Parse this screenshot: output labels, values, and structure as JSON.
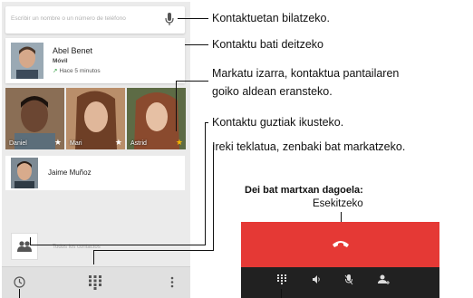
{
  "phone": {
    "search": {
      "placeholder": "Escribir un nombre o un número de teléfono",
      "icon": "mic-icon"
    },
    "recent_contact": {
      "name": "Abel Benet",
      "type": "Móvil",
      "time": "Hace 5 minutos"
    },
    "favorites": [
      {
        "name": "Daniel",
        "starred": true
      },
      {
        "name": "Mari",
        "starred": true
      },
      {
        "name": "Astrid",
        "starred": true
      }
    ],
    "contact_row": {
      "name": "Jaime Muñoz"
    },
    "all_contacts_text": "Todos los contactos",
    "bottom_icons": [
      "clock-icon",
      "dialpad-icon",
      "more-vert-icon"
    ]
  },
  "callouts": {
    "search": "Kontaktuetan bilatzeko.",
    "call_contact": "Kontaktu bati deitzeko",
    "star_line1": "Markatu izarra, kontaktua pantailaren",
    "star_line2": "goiko aldean eransteko.",
    "all_contacts": "Kontaktu guztiak ikusteko.",
    "dialpad": "Ireki teklatua, zenbaki bat markatzeko."
  },
  "call_panel": {
    "heading": "Dei bat martxan dagoela:",
    "hangup_label": "Esekitzeko",
    "icons": [
      "end-call-icon",
      "dialpad-icon",
      "speaker-icon",
      "mute-icon",
      "add-call-icon"
    ]
  },
  "colors": {
    "star": "#f5b800",
    "call_red": "#e53935",
    "call_dark": "#212121",
    "recent_arrow": "#2e9e3e"
  }
}
